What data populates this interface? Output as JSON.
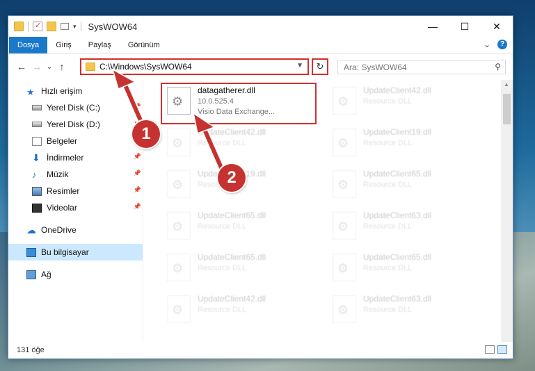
{
  "window": {
    "title": "SysWOW64",
    "controls": {
      "minimize": "—",
      "maximize": "☐",
      "close": "✕"
    }
  },
  "ribbon": {
    "tabs": [
      "Dosya",
      "Giriş",
      "Paylaş",
      "Görünüm"
    ],
    "collapse": "⌄"
  },
  "address": {
    "back": "←",
    "forward": "→",
    "history": "⌄",
    "up": "↑",
    "path": "C:\\Windows\\SysWOW64",
    "refresh": "↻",
    "search_placeholder": "Ara: SysWOW64"
  },
  "nav": {
    "quick_access": "Hızlı erişim",
    "items": [
      {
        "label": "Yerel Disk (C:)",
        "icon": "disk-icon"
      },
      {
        "label": "Yerel Disk (D:)",
        "icon": "disk-icon"
      },
      {
        "label": "Belgeler",
        "icon": "documents-icon"
      },
      {
        "label": "İndirmeler",
        "icon": "downloads-icon"
      },
      {
        "label": "Müzik",
        "icon": "music-icon"
      },
      {
        "label": "Resimler",
        "icon": "pictures-icon"
      },
      {
        "label": "Videolar",
        "icon": "videos-icon"
      }
    ],
    "onedrive": "OneDrive",
    "this_pc": "Bu bilgisayar",
    "network": "Ağ"
  },
  "files": {
    "highlighted": {
      "name": "datagatherer.dll",
      "version": "10.0.525.4",
      "description": "Visio Data Exchange..."
    },
    "left_column": [
      {
        "name": "UpdateClient42.dll",
        "description": "Resource DLL"
      },
      {
        "name": "UpdateClient19.dll",
        "description": "Resource DLL"
      },
      {
        "name": "UpdateClient65.dll",
        "description": "Resource DLL"
      },
      {
        "name": "UpdateClient65.dll",
        "description": "Resource DLL"
      },
      {
        "name": "UpdateClient42.dll",
        "description": "Resource DLL"
      }
    ],
    "right_column": [
      {
        "name": "UpdateClient42.dll",
        "description": "Resource DLL"
      },
      {
        "name": "UpdateClient19.dll",
        "description": "Resource DLL"
      },
      {
        "name": "UpdateClient65.dll",
        "description": "Resource DLL"
      },
      {
        "name": "UpdateClient63.dll",
        "description": "Resource DLL"
      },
      {
        "name": "UpdateClient65.dll",
        "description": "Resource DLL"
      },
      {
        "name": "UpdateClient63.dll",
        "description": "Resource DLL"
      }
    ]
  },
  "status": {
    "count": "131 öğe"
  },
  "annotations": {
    "step1": "1",
    "step2": "2"
  },
  "colors": {
    "accent": "#1979ca",
    "highlight": "#d32f2f",
    "badge": "#c6322f"
  }
}
